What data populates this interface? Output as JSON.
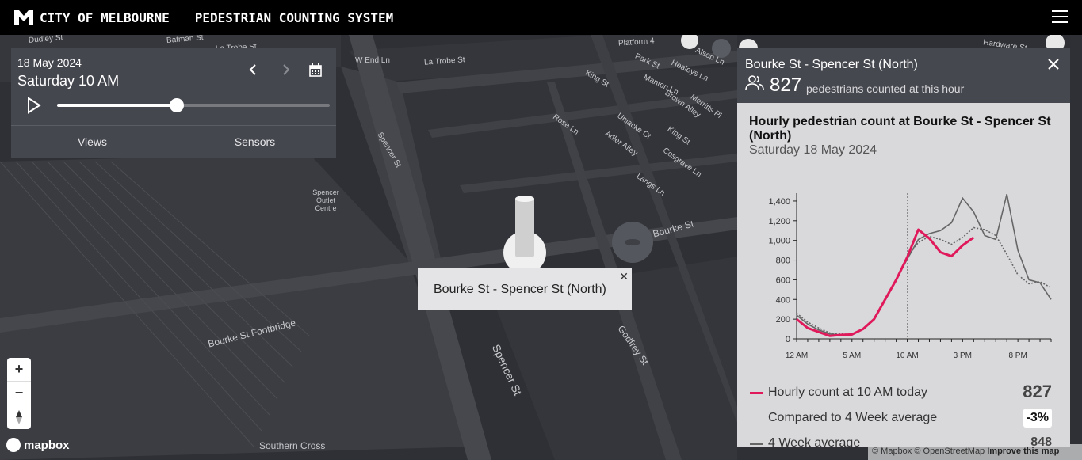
{
  "header": {
    "brand": "City of Melbourne",
    "app_title": "Pedestrian Counting System",
    "menu_icon": "hamburger-icon"
  },
  "control_panel": {
    "date": "18 May 2024",
    "time": "Saturday 10 AM",
    "slider_progress": 0.44,
    "tabs": [
      "Views",
      "Sensors"
    ]
  },
  "map": {
    "labels": [
      {
        "text": "Dudley St"
      },
      {
        "text": "Batman St"
      },
      {
        "text": "La Trobe St"
      },
      {
        "text": "W End Ln"
      },
      {
        "text": "La Trobe St"
      },
      {
        "text": "Platform 4"
      },
      {
        "text": "Park St"
      },
      {
        "text": "Alsop Ln"
      },
      {
        "text": "Healeys Ln"
      },
      {
        "text": "Hardware St"
      },
      {
        "text": "King St"
      },
      {
        "text": "Manton Ln"
      },
      {
        "text": "Brown Alley"
      },
      {
        "text": "Merritts Pl"
      },
      {
        "text": "Rose Ln"
      },
      {
        "text": "Uniacke Ct"
      },
      {
        "text": "King St"
      },
      {
        "text": "Spencer St"
      },
      {
        "text": "Adler Alley"
      },
      {
        "text": "Cosgrave Ln"
      },
      {
        "text": "Spencer Outlet Centre"
      },
      {
        "text": "Langs Ln"
      },
      {
        "text": "Bourke St"
      },
      {
        "text": "Bourke St Footbridge"
      },
      {
        "text": "Godfrey St"
      },
      {
        "text": "Spencer St"
      },
      {
        "text": "Southern Cross"
      }
    ],
    "tooltip": "Bourke St - Spencer St (North)",
    "attribution": {
      "mapbox": "© Mapbox",
      "osm": "© OpenStreetMap",
      "improve": "Improve this map"
    },
    "logo": "mapbox"
  },
  "info_panel": {
    "title": "Bourke St - Spencer St (North)",
    "count": "827",
    "count_label": "pedestrians counted at this hour",
    "chart_title": "Hourly pedestrian count at Bourke St - Spencer St (North)",
    "chart_subtitle": "Saturday 18 May 2024",
    "legend": [
      {
        "label": "Hourly count at 10 AM today",
        "value": "827",
        "color": "#e0195b"
      },
      {
        "label": "Compared to 4 Week average",
        "badge": "-3%"
      },
      {
        "label": "4 Week average",
        "value": "848",
        "color": "#666666"
      }
    ]
  },
  "chart_data": {
    "type": "line",
    "title": "Hourly pedestrian count at Bourke St - Spencer St (North)",
    "subtitle": "Saturday 18 May 2024",
    "x_ticks": [
      "12 AM",
      "5 AM",
      "10 AM",
      "3 PM",
      "8 PM"
    ],
    "y_ticks": [
      "0",
      "200",
      "400",
      "600",
      "800",
      "1,000",
      "1,200",
      "1,400"
    ],
    "ylim": [
      0,
      1480
    ],
    "x": [
      0,
      1,
      2,
      3,
      4,
      5,
      6,
      7,
      8,
      9,
      10,
      11,
      12,
      13,
      14,
      15,
      16,
      17,
      18,
      19,
      20,
      21,
      22,
      23
    ],
    "current_hour": 10,
    "series": [
      {
        "values": [
          200,
          110,
          70,
          30,
          40,
          45,
          100,
          200,
          400,
          600,
          830,
          1110,
          1020,
          880,
          840,
          950,
          1030
        ],
        "color": "#e0195b",
        "style": "bold"
      },
      {
        "values": [
          240,
          150,
          90,
          50,
          40,
          40,
          100,
          200,
          400,
          600,
          810,
          1010,
          1070,
          1100,
          1180,
          1430,
          1290,
          1050,
          1010,
          1470,
          900,
          600,
          570,
          400
        ],
        "color": "#666666",
        "style": "solid"
      },
      {
        "values": [
          260,
          170,
          110,
          60,
          50,
          45,
          100,
          200,
          390,
          590,
          830,
          980,
          1040,
          1010,
          960,
          1030,
          1130,
          1110,
          1050,
          860,
          650,
          560,
          580,
          520
        ],
        "color": "#666666",
        "style": "dotted"
      }
    ]
  }
}
